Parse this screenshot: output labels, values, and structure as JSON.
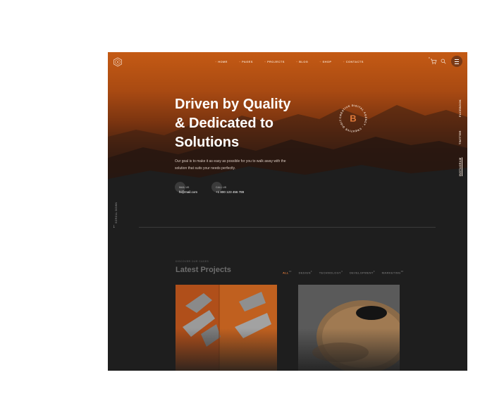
{
  "nav": {
    "items": [
      "HOME",
      "PAGES",
      "PROJECTS",
      "BLOG",
      "SHOP",
      "CONTACTS"
    ],
    "cart_count": "0",
    "accent": "#e07a3a"
  },
  "icons": {
    "logo": "logo-icon",
    "cart": "cart-icon",
    "search": "search-icon",
    "menu": "menu-icon",
    "scroll": "arrow-down-icon"
  },
  "social": [
    "FACEBOOK",
    "TWITTER",
    "INSTAGRAM"
  ],
  "hero": {
    "headline_line1": "Driven by Quality",
    "headline_line2": "& Dedicated to",
    "headline_line3": "Solutions",
    "intro": "Our goal is to make it as easy as possible for you to walk away with the solution that suits your needs perfectly.",
    "badge_letter": "B",
    "badge_text": "CREATIVE DIGITAL AGENCY · CREATIVE DIGITAL AGENCY ·"
  },
  "contacts": {
    "mail_label": "MAIL US",
    "mail_value": "hi@mail.com",
    "call_label": "CALL US",
    "call_value": "+1 800 123 456 789"
  },
  "scroll_label": "SCROLL DOWN",
  "projects": {
    "eyebrow": "DISCOVER OUR CASES",
    "title": "Latest Projects",
    "filters": [
      {
        "label": "ALL",
        "count": "10",
        "active": true
      },
      {
        "label": "DESIGN",
        "count": "4",
        "active": false
      },
      {
        "label": "TECHNOLOGY",
        "count": "4",
        "active": false
      },
      {
        "label": "DEVELOPMENT",
        "count": "3",
        "active": false
      },
      {
        "label": "MARKETING",
        "count": "10",
        "active": false
      }
    ]
  }
}
